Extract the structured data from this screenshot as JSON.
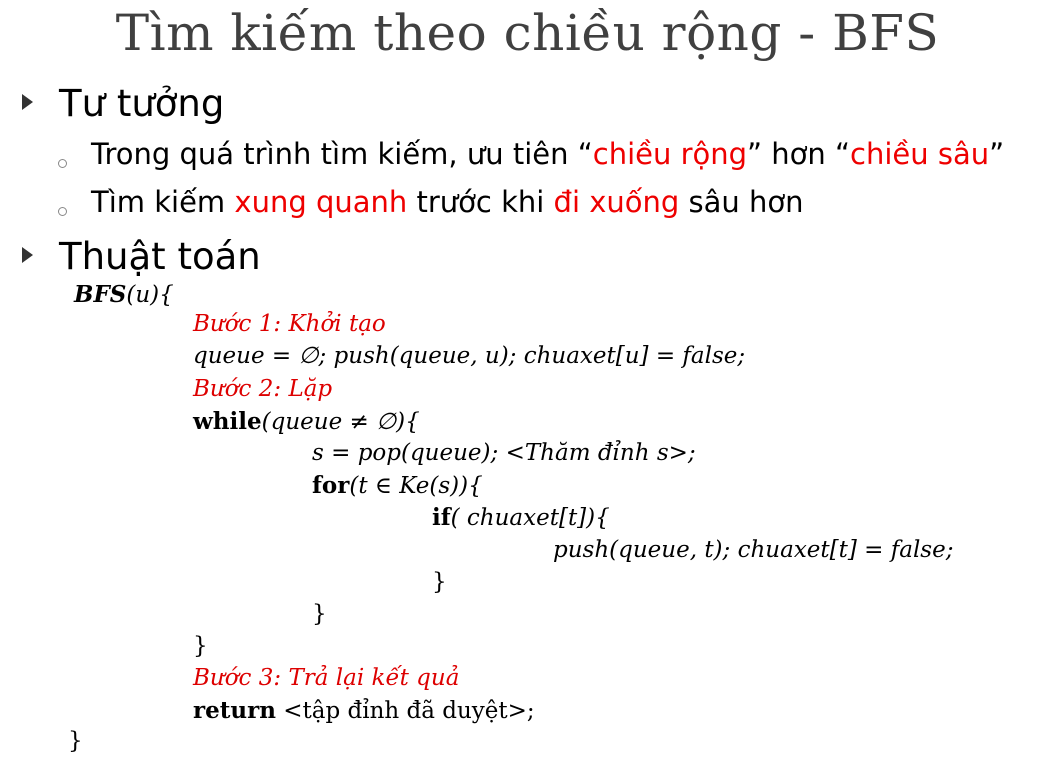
{
  "slide": {
    "title": "Tìm kiếm theo chiều rộng - BFS",
    "sections": [
      {
        "heading": "Tư tưởng",
        "bullets": [
          {
            "parts": [
              "Trong quá trình tìm kiếm, ưu tiên “",
              "chiều rộng",
              "” hơn “",
              "chiều sâu",
              "”"
            ]
          },
          {
            "parts": [
              "Tìm kiếm ",
              "xung quanh",
              " trước khi ",
              "đi xuống",
              " sâu hơn"
            ]
          }
        ]
      },
      {
        "heading": "Thuật toán"
      }
    ],
    "highlight_color": "#ee0000"
  },
  "code": {
    "fn_name": "BFS",
    "fn_sig_rest": "(u){",
    "step1": "Bước 1: Khởi tạo",
    "init_line": "queue = ∅; push(queue, u); chuaxet[u]  =  false;",
    "step2": "Bước 2: Lặp",
    "while_kw": "while",
    "while_cond": "(queue ≠ ∅){",
    "pop_line": "s = pop(queue); <Thăm đỉnh s>;",
    "for_kw": "for",
    "for_cond": "(t ∈ Ke(s)){",
    "if_kw": "if",
    "if_cond": "( chuaxet[t]){",
    "push_line": "push(queue, t); chuaxet[t]  =  false;",
    "close_if": "}",
    "close_for": "}",
    "close_while": "}",
    "step3": "Bước 3: Trả lại kết quả",
    "return_kw": "return",
    "return_rest": " <tập đỉnh đã duyệt>;",
    "close_fn": "}"
  }
}
